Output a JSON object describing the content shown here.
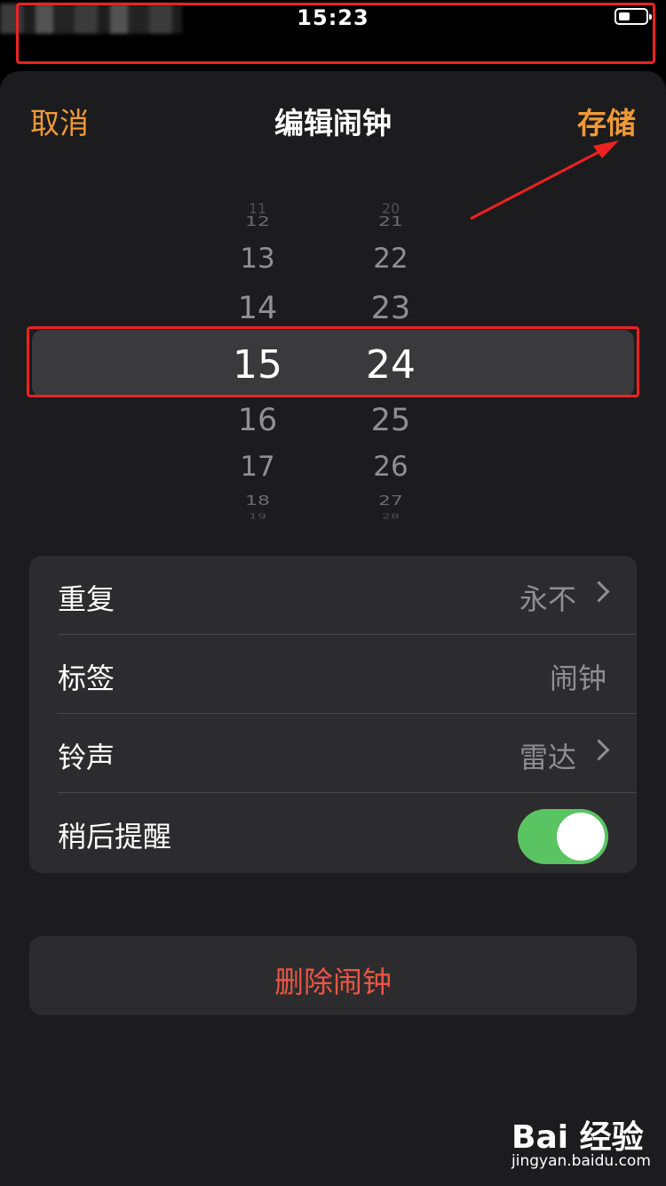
{
  "status_bar": {
    "time": "15:23"
  },
  "nav": {
    "cancel_label": "取消",
    "title": "编辑闹钟",
    "save_label": "存储"
  },
  "picker": {
    "hours": [
      "11",
      "12",
      "13",
      "14",
      "15",
      "16",
      "17",
      "18",
      "19"
    ],
    "minutes": [
      "20",
      "21",
      "22",
      "23",
      "24",
      "25",
      "26",
      "27",
      "28"
    ],
    "selected_hour": "15",
    "selected_minute": "24"
  },
  "settings": {
    "rows": [
      {
        "label": "重复",
        "value": "永不"
      },
      {
        "label": "标签",
        "value": "闹钟"
      },
      {
        "label": "铃声",
        "value": "雷达"
      },
      {
        "label": "稍后提醒",
        "toggle_on": true
      }
    ]
  },
  "delete_label": "删除闹钟",
  "watermark": {
    "logo": "Bai 经验",
    "url": "jingyan.baidu.com"
  },
  "colors": {
    "accent": "#f09a37",
    "destructive": "#eb5545",
    "toggle_on": "#5ac463",
    "annotation": "#ee2222"
  }
}
